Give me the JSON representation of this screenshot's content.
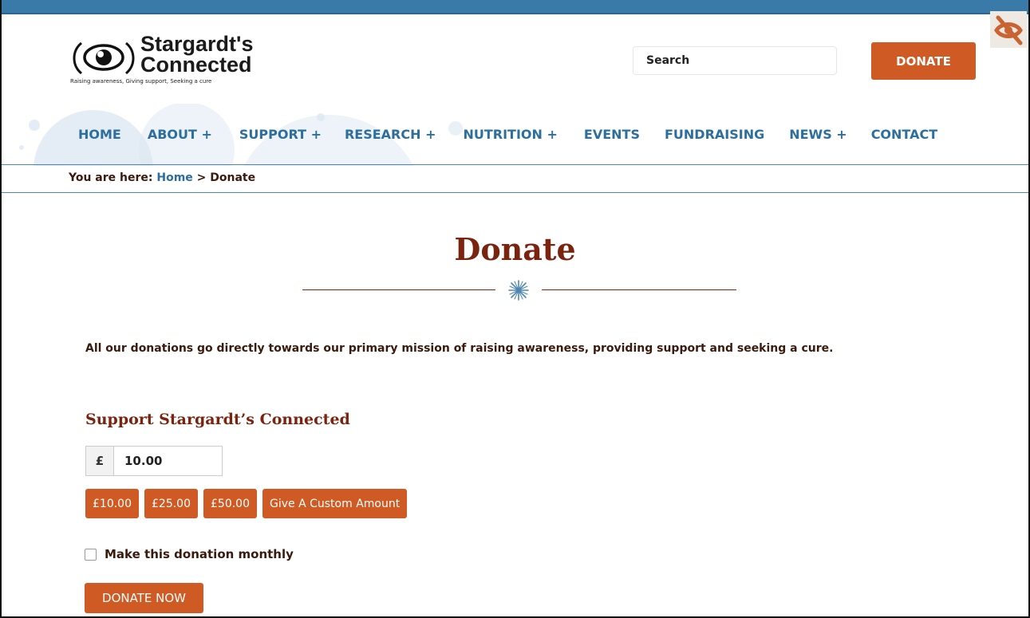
{
  "header": {
    "logo_name": "Stargardt's\nConnected",
    "logo_tagline": "Raising awareness, Giving support, Seeking a cure",
    "search_placeholder": "Search",
    "donate_label": "DONATE"
  },
  "nav": {
    "items": [
      {
        "label": "HOME"
      },
      {
        "label": "ABOUT +"
      },
      {
        "label": "SUPPORT +"
      },
      {
        "label": "RESEARCH +"
      },
      {
        "label": "NUTRITION +"
      },
      {
        "label": "EVENTS"
      },
      {
        "label": "FUNDRAISING"
      },
      {
        "label": "NEWS +"
      },
      {
        "label": "CONTACT"
      }
    ]
  },
  "breadcrumb": {
    "prefix": "You are here: ",
    "home": "Home",
    "separator": " > ",
    "current": "Donate"
  },
  "main": {
    "title": "Donate",
    "intro": "All our donations go directly towards our primary mission of raising awareness, providing support and seeking a cure."
  },
  "form": {
    "title": "Support Stargardt’s Connected",
    "currency_symbol": "£",
    "amount_value": "10.00",
    "levels": [
      "£10.00",
      "£25.00",
      "£50.00",
      "Give A Custom Amount"
    ],
    "monthly_label": "Make this donation monthly",
    "monthly_checked": false,
    "submit_label": "DONATE NOW"
  },
  "colors": {
    "accent": "#d05a24",
    "link": "#2c6f9e",
    "heading": "#7a2410",
    "topbar": "#3a7aa8"
  },
  "icons": {
    "accessibility_toggle": "eye-slash-icon",
    "logo": "eye-logo-icon",
    "divider": "star-burst-icon"
  }
}
